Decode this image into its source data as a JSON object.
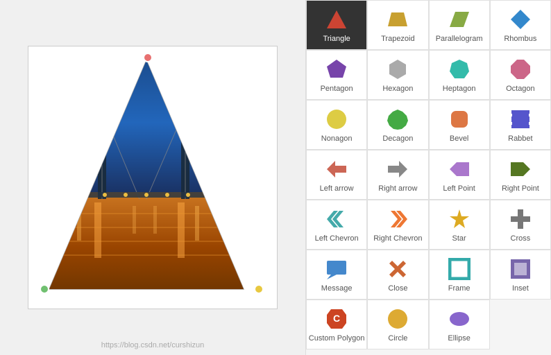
{
  "canvas": {
    "watermark": "https://blog.csdn.net/curshizun"
  },
  "shapes": [
    {
      "id": "triangle",
      "label": "Triangle",
      "active": true,
      "color": "#cc4433",
      "shape": "triangle"
    },
    {
      "id": "trapezoid",
      "label": "Trapezoid",
      "active": false,
      "color": "#c8a030",
      "shape": "trapezoid"
    },
    {
      "id": "parallelogram",
      "label": "Parallelogram",
      "active": false,
      "color": "#88aa44",
      "shape": "parallelogram"
    },
    {
      "id": "rhombus",
      "label": "Rhombus",
      "active": false,
      "color": "#3388cc",
      "shape": "rhombus"
    },
    {
      "id": "pentagon",
      "label": "Pentagon",
      "active": false,
      "color": "#7744aa",
      "shape": "pentagon"
    },
    {
      "id": "hexagon",
      "label": "Hexagon",
      "active": false,
      "color": "#aaaaaa",
      "shape": "hexagon"
    },
    {
      "id": "heptagon",
      "label": "Heptagon",
      "active": false,
      "color": "#33bbaa",
      "shape": "heptagon"
    },
    {
      "id": "octagon",
      "label": "Octagon",
      "active": false,
      "color": "#cc6688",
      "shape": "octagon"
    },
    {
      "id": "nonagon",
      "label": "Nonagon",
      "active": false,
      "color": "#ddcc44",
      "shape": "nonagon"
    },
    {
      "id": "decagon",
      "label": "Decagon",
      "active": false,
      "color": "#44aa44",
      "shape": "decagon"
    },
    {
      "id": "bevel",
      "label": "Bevel",
      "active": false,
      "color": "#dd7744",
      "shape": "bevel"
    },
    {
      "id": "rabbet",
      "label": "Rabbet",
      "active": false,
      "color": "#5555cc",
      "shape": "rabbet"
    },
    {
      "id": "left-arrow",
      "label": "Left arrow",
      "active": false,
      "color": "#cc6655",
      "shape": "left-arrow"
    },
    {
      "id": "right-arrow",
      "label": "Right arrow",
      "active": false,
      "color": "#888888",
      "shape": "right-arrow"
    },
    {
      "id": "left-point",
      "label": "Left Point",
      "active": false,
      "color": "#aa77cc",
      "shape": "left-point"
    },
    {
      "id": "right-point",
      "label": "Right Point",
      "active": false,
      "color": "#557722",
      "shape": "right-point"
    },
    {
      "id": "left-chevron",
      "label": "Left Chevron",
      "active": false,
      "color": "#44aaaa",
      "shape": "left-chevron"
    },
    {
      "id": "right-chevron",
      "label": "Right Chevron",
      "active": false,
      "color": "#ee7733",
      "shape": "right-chevron"
    },
    {
      "id": "star",
      "label": "Star",
      "active": false,
      "color": "#ddaa22",
      "shape": "star"
    },
    {
      "id": "cross",
      "label": "Cross",
      "active": false,
      "color": "#777777",
      "shape": "cross"
    },
    {
      "id": "message",
      "label": "Message",
      "active": false,
      "color": "#4488cc",
      "shape": "message"
    },
    {
      "id": "close",
      "label": "Close",
      "active": false,
      "color": "#cc6633",
      "shape": "close"
    },
    {
      "id": "frame",
      "label": "Frame",
      "active": false,
      "color": "#33aaaa",
      "shape": "frame"
    },
    {
      "id": "inset",
      "label": "Inset",
      "active": false,
      "color": "#7766aa",
      "shape": "inset"
    },
    {
      "id": "custom-polygon",
      "label": "Custom Polygon",
      "active": false,
      "color": "#cc4422",
      "shape": "custom-polygon"
    },
    {
      "id": "circle",
      "label": "Circle",
      "active": false,
      "color": "#ddaa33",
      "shape": "circle"
    },
    {
      "id": "ellipse",
      "label": "Ellipse",
      "active": false,
      "color": "#8866cc",
      "shape": "ellipse"
    }
  ]
}
